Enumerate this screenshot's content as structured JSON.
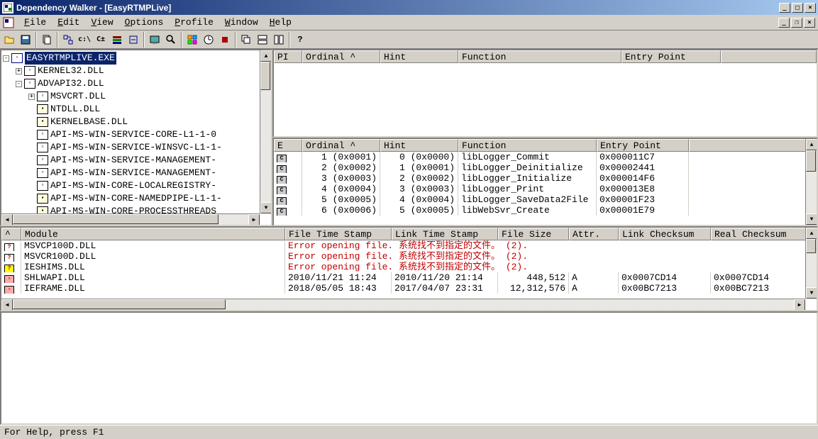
{
  "titlebar": {
    "app_name": "Dependency Walker",
    "doc_name": "[EasyRTMPLive]"
  },
  "menu": {
    "file": "File",
    "edit": "Edit",
    "view": "View",
    "options": "Options",
    "profile": "Profile",
    "window": "Window",
    "help": "Help"
  },
  "tree": {
    "root": "EASYRTMPLIVE.EXE",
    "items": [
      "KERNEL32.DLL",
      "ADVAPI32.DLL",
      "MSVCRT.DLL",
      "NTDLL.DLL",
      "KERNELBASE.DLL",
      "API-MS-WIN-SERVICE-CORE-L1-1-0",
      "API-MS-WIN-SERVICE-WINSVC-L1-1-",
      "API-MS-WIN-SERVICE-MANAGEMENT-",
      "API-MS-WIN-SERVICE-MANAGEMENT-",
      "API-MS-WIN-CORE-LOCALREGISTRY-",
      "API-MS-WIN-CORE-NAMEDPIPE-L1-1-",
      "API-MS-WIN-CORE-PROCESSTHREADS"
    ]
  },
  "imports_header": {
    "c0": "PI",
    "c1": "Ordinal ^",
    "c2": "Hint",
    "c3": "Function",
    "c4": "Entry Point"
  },
  "exports_header": {
    "c0": "E",
    "c1": "Ordinal ^",
    "c2": "Hint",
    "c3": "Function",
    "c4": "Entry Point"
  },
  "exports": [
    {
      "ord": "1 (0x0001)",
      "hint": "0 (0x0000)",
      "func": "libLogger_Commit",
      "ep": "0x000011C7"
    },
    {
      "ord": "2 (0x0002)",
      "hint": "1 (0x0001)",
      "func": "libLogger_Deinitialize",
      "ep": "0x00002441"
    },
    {
      "ord": "3 (0x0003)",
      "hint": "2 (0x0002)",
      "func": "libLogger_Initialize",
      "ep": "0x000014F6"
    },
    {
      "ord": "4 (0x0004)",
      "hint": "3 (0x0003)",
      "func": "libLogger_Print",
      "ep": "0x000013E8"
    },
    {
      "ord": "5 (0x0005)",
      "hint": "4 (0x0004)",
      "func": "libLogger_SaveData2File",
      "ep": "0x00001F23"
    },
    {
      "ord": "6 (0x0006)",
      "hint": "5 (0x0005)",
      "func": "libWebSvr_Create",
      "ep": "0x00001E79"
    }
  ],
  "modules_header": {
    "c0": "^",
    "c1": "Module",
    "c2": "File Time Stamp",
    "c3": "Link Time Stamp",
    "c4": "File Size",
    "c5": "Attr.",
    "c6": "Link Checksum",
    "c7": "Real Checksum"
  },
  "modules": [
    {
      "name": "MSVCP100D.DLL",
      "err": "Error opening file. 系统找不到指定的文件。 (2)."
    },
    {
      "name": "MSVCR100D.DLL",
      "err": "Error opening file. 系统找不到指定的文件。 (2)."
    },
    {
      "name": "IESHIMS.DLL",
      "err": "Error opening file. 系统找不到指定的文件。 (2)."
    },
    {
      "name": "SHLWAPI.DLL",
      "fts": "2010/11/21 11:24",
      "lts": "2010/11/20 21:14",
      "size": "448,512",
      "attr": "A",
      "lchk": "0x0007CD14",
      "rchk": "0x0007CD14"
    },
    {
      "name": "IEFRAME.DLL",
      "fts": "2018/05/05 18:43",
      "lts": "2017/04/07 23:31",
      "size": "12,312,576",
      "attr": "A",
      "lchk": "0x00BC7213",
      "rchk": "0x00BC7213"
    }
  ],
  "statusbar": {
    "text": "For Help, press F1"
  }
}
